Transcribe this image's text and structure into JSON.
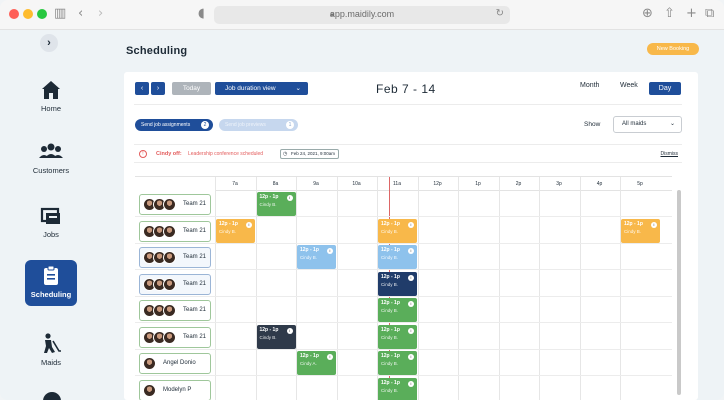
{
  "browser": {
    "url": "app.maidily.com"
  },
  "sidebar": {
    "items": [
      {
        "label": "Home",
        "icon": "home-icon"
      },
      {
        "label": "Customers",
        "icon": "customers-icon"
      },
      {
        "label": "Jobs",
        "icon": "jobs-icon"
      },
      {
        "label": "Scheduling",
        "icon": "scheduling-icon",
        "active": true
      },
      {
        "label": "Maids",
        "icon": "maids-icon"
      }
    ]
  },
  "header": {
    "title": "Scheduling",
    "new_booking": "New Booking"
  },
  "toolbar": {
    "prev": "‹",
    "next": "›",
    "today": "Today",
    "view": "Job duration view",
    "range": "Feb 7 - 14",
    "tabs": {
      "month": "Month",
      "week": "Week",
      "day": "Day"
    }
  },
  "filters": {
    "send_assignments": "Send job assignments",
    "send_assignments_count": "2",
    "send_previews": "Send job previews",
    "send_previews_count": "1",
    "show_label": "Show",
    "show_value": "All maids"
  },
  "alert": {
    "name": "Cindy off:",
    "message": "Leadership conference scheduled",
    "date": "Feb 24, 2021, 9:00am",
    "dismiss": "Dismiss"
  },
  "schedule": {
    "hours": [
      "7a",
      "8a",
      "9a",
      "10a",
      "11a",
      "12p",
      "1p",
      "2p",
      "3p",
      "4p",
      "5p"
    ],
    "rows": [
      {
        "team": "Team 21",
        "style": "green"
      },
      {
        "team": "Team 21",
        "style": "green"
      },
      {
        "team": "Team 21",
        "style": "blue"
      },
      {
        "team": "Team 21",
        "style": "blue"
      },
      {
        "team": "Team 21",
        "style": "green"
      },
      {
        "team": "Team 21",
        "style": "green"
      },
      {
        "team": "Angel Donio",
        "style": "green"
      },
      {
        "team": "Modelyn P",
        "style": "green"
      }
    ],
    "jobs": [
      {
        "row": 0,
        "hour": 1,
        "time": "12p - 1p",
        "name": "Cindy B.",
        "color": "g"
      },
      {
        "row": 1,
        "hour": 0,
        "time": "12p - 1p",
        "name": "Cindy B.",
        "color": "o"
      },
      {
        "row": 1,
        "hour": 4,
        "time": "12p - 1p",
        "name": "Cindy B.",
        "color": "o"
      },
      {
        "row": 1,
        "hour": 10,
        "time": "12p - 1p",
        "name": "Cindy B.",
        "color": "o"
      },
      {
        "row": 2,
        "hour": 2,
        "time": "12p - 1p",
        "name": "Cindy B.",
        "color": "lb"
      },
      {
        "row": 2,
        "hour": 4,
        "time": "12p - 1p",
        "name": "Cindy B.",
        "color": "lb"
      },
      {
        "row": 3,
        "hour": 4,
        "time": "12p - 1p",
        "name": "Cindy B.",
        "color": "db"
      },
      {
        "row": 4,
        "hour": 4,
        "time": "12p - 1p",
        "name": "Cindy B.",
        "color": "g"
      },
      {
        "row": 5,
        "hour": 1,
        "time": "12p - 1p",
        "name": "Cindy B.",
        "color": "dk"
      },
      {
        "row": 5,
        "hour": 4,
        "time": "12p - 1p",
        "name": "Cindy B.",
        "color": "g"
      },
      {
        "row": 6,
        "hour": 2,
        "time": "12p - 1p",
        "name": "Cindy A.",
        "color": "g"
      },
      {
        "row": 6,
        "hour": 4,
        "time": "12p - 1p",
        "name": "Cindy B.",
        "color": "g"
      },
      {
        "row": 7,
        "hour": 4,
        "time": "12p - 1p",
        "name": "Cindy B.",
        "color": "g"
      }
    ]
  }
}
